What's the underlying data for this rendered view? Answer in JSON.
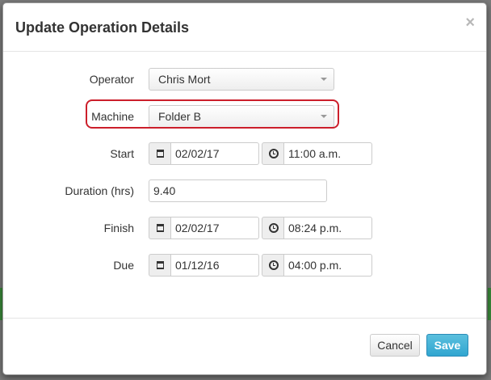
{
  "modal": {
    "title": "Update Operation Details",
    "close_symbol": "×"
  },
  "form": {
    "operator": {
      "label": "Operator",
      "value": "Chris Mort"
    },
    "machine": {
      "label": "Machine",
      "value": "Folder B"
    },
    "start": {
      "label": "Start",
      "date": "02/02/17",
      "time": "11:00 a.m."
    },
    "duration": {
      "label": "Duration (hrs)",
      "value": "9.40"
    },
    "finish": {
      "label": "Finish",
      "date": "02/02/17",
      "time": "08:24 p.m."
    },
    "due": {
      "label": "Due",
      "date": "01/12/16",
      "time": "04:00 p.m."
    }
  },
  "footer": {
    "cancel_label": "Cancel",
    "save_label": "Save"
  },
  "icons": {
    "calendar": "calendar-icon",
    "clock": "clock-icon",
    "caret": "chevron-down-icon"
  },
  "colors": {
    "highlight": "#cc1f2b",
    "save_button": "#31a6d0"
  }
}
